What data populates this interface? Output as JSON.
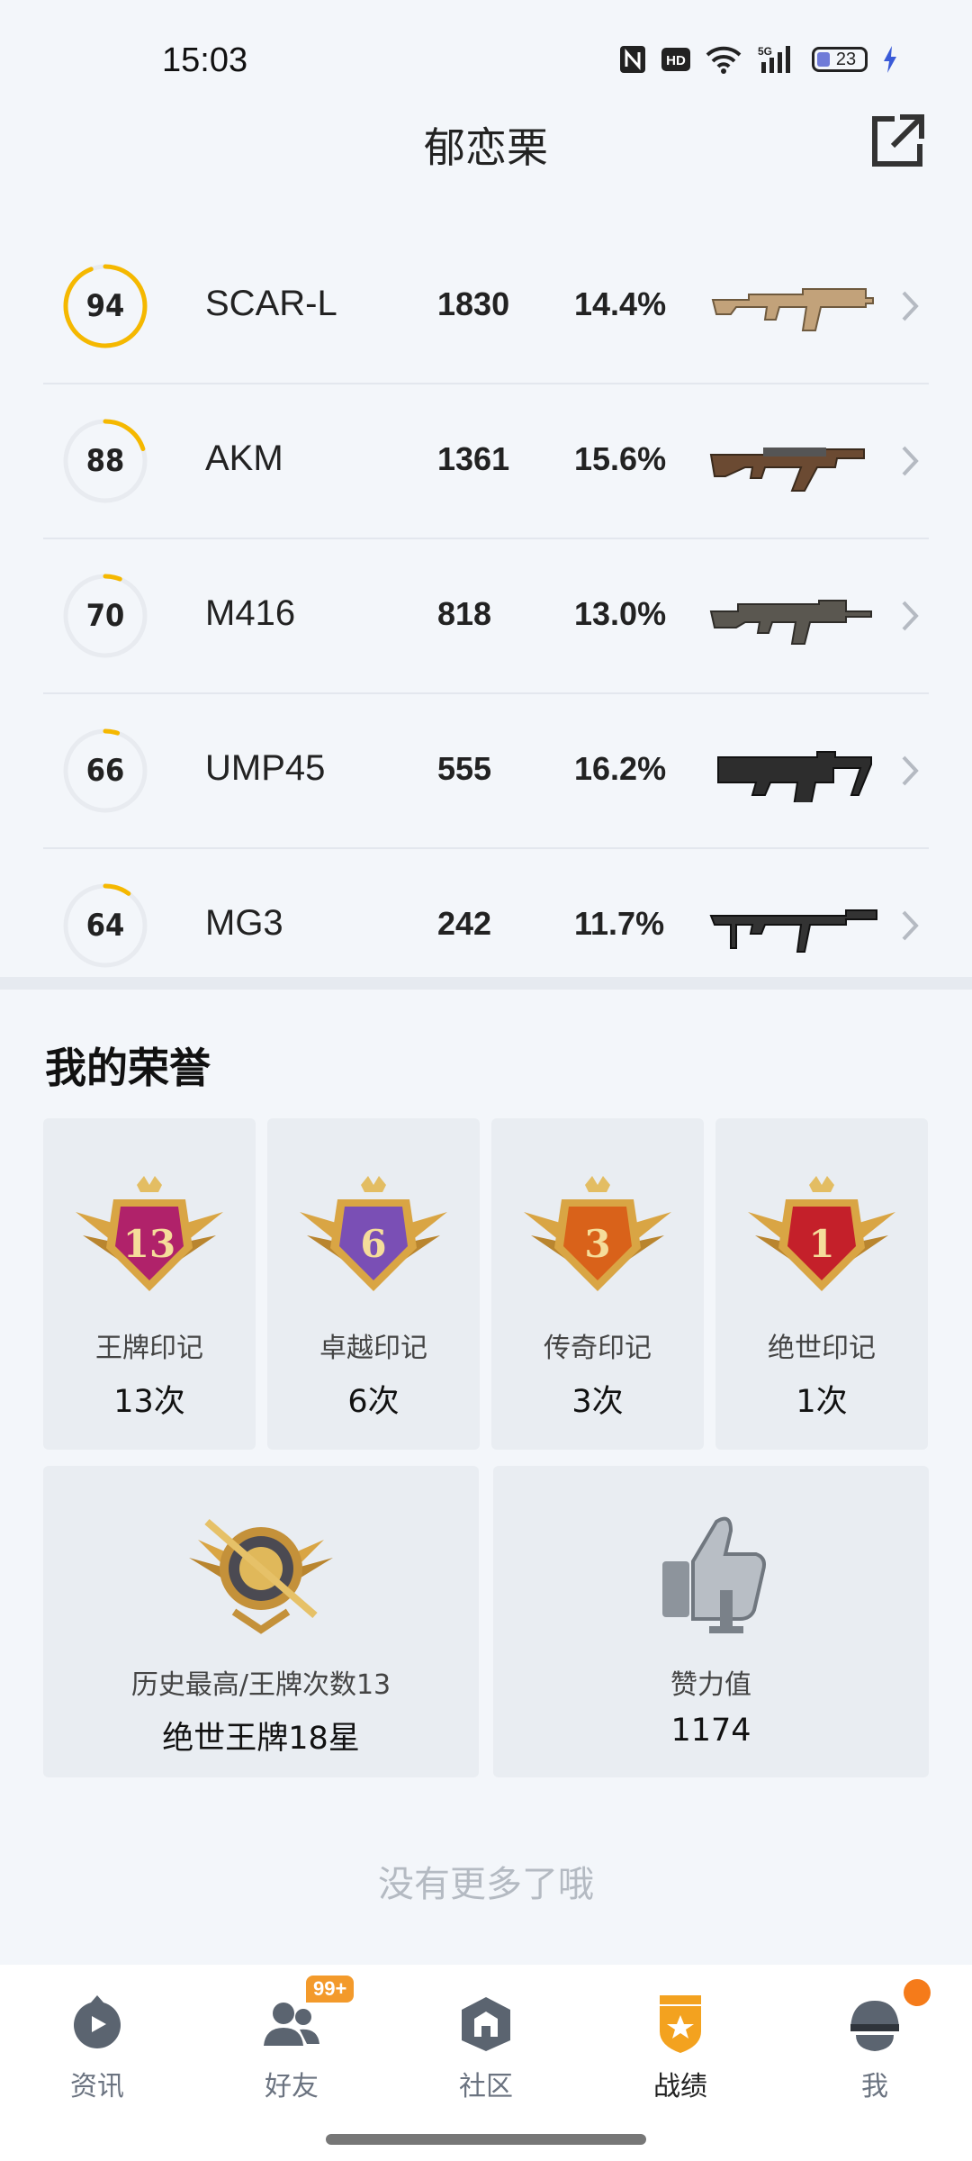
{
  "status_bar": {
    "time": "15:03",
    "icons": [
      "nfc-icon",
      "hd-icon",
      "wifi-icon",
      "5g-signal-icon",
      "battery-icon",
      "charging-icon"
    ],
    "battery_level": "23"
  },
  "header": {
    "title": "郁恋栗",
    "share_icon": "share-external-icon"
  },
  "weapons": [
    {
      "score": "94",
      "score_pct": 0.94,
      "name": "SCAR-L",
      "kills": "1830",
      "pct": "14.4%",
      "image": "scar-l-rifle"
    },
    {
      "score": "88",
      "score_pct": 0.2,
      "name": "AKM",
      "kills": "1361",
      "pct": "15.6%",
      "image": "akm-rifle"
    },
    {
      "score": "70",
      "score_pct": 0.06,
      "name": "M416",
      "kills": "818",
      "pct": "13.0%",
      "image": "m416-rifle"
    },
    {
      "score": "66",
      "score_pct": 0.05,
      "name": "UMP45",
      "kills": "555",
      "pct": "16.2%",
      "image": "ump45-smg"
    },
    {
      "score": "64",
      "score_pct": 0.1,
      "name": "MG3",
      "kills": "242",
      "pct": "11.7%",
      "image": "mg3-machine-gun"
    }
  ],
  "colors": {
    "ring_active": "#f5b800",
    "ring_track": "#e8ebf0",
    "accent_orange": "#f39a2b",
    "background": "#f3f6fa"
  },
  "honors": {
    "title": "我的荣誉",
    "marks": [
      {
        "badge_number": "13",
        "label": "王牌印记",
        "count": "13次",
        "color": "#b0226a"
      },
      {
        "badge_number": "6",
        "label": "卓越印记",
        "count": "6次",
        "color": "#7a4fb5"
      },
      {
        "badge_number": "3",
        "label": "传奇印记",
        "count": "3次",
        "color": "#d9621a"
      },
      {
        "badge_number": "1",
        "label": "绝世印记",
        "count": "1次",
        "color": "#c4202a"
      }
    ],
    "highest": {
      "label": "历史最高/王牌次数13",
      "value": "绝世王牌18星"
    },
    "likes": {
      "label": "赞力值",
      "value": "1174"
    }
  },
  "footer_text": "没有更多了哦",
  "tabs": [
    {
      "label": "资讯",
      "icon": "news-play-icon",
      "active": false
    },
    {
      "label": "好友",
      "icon": "friends-icon",
      "active": false,
      "badge": "99+"
    },
    {
      "label": "社区",
      "icon": "community-icon",
      "active": false
    },
    {
      "label": "战绩",
      "icon": "record-shield-icon",
      "active": true
    },
    {
      "label": "我",
      "icon": "profile-helmet-icon",
      "active": false,
      "dot": true
    }
  ]
}
